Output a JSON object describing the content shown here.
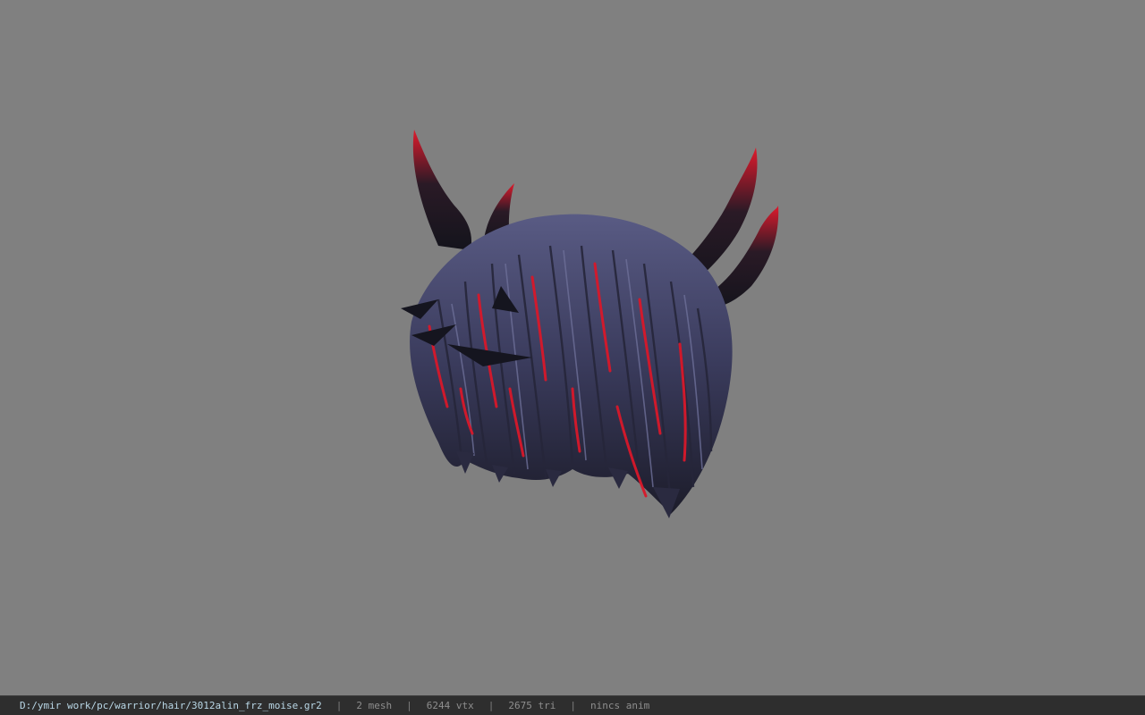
{
  "viewport": {
    "background_color": "#808080",
    "model_colors": {
      "dark": "#1a1a26",
      "mid": "#3e3f63",
      "light": "#6f7299",
      "accent": "#d8182a"
    }
  },
  "statusbar": {
    "file_path": "D:/ymir work/pc/warrior/hair/3012alin_frz_moise.gr2",
    "separator": "|",
    "mesh": "2 mesh",
    "vertices": "6244 vtx",
    "triangles": "2675 tri",
    "anim": "nincs anim"
  }
}
